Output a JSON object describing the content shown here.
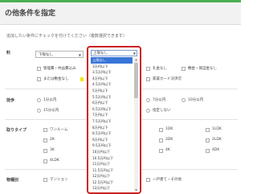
{
  "header": {
    "title": "の他条件を指定"
  },
  "instruction": "追加したい条件にチェックを付けてください（複数選択できます）",
  "rows": {
    "rent": {
      "label": "料",
      "min_select": "下限なし",
      "checkboxes_left": [
        "管理費・共益費込み",
        "または敷金なし"
      ],
      "checkboxes_right": [
        "礼金なし",
        "敷金・保証金なし",
        "家賃カード決済可"
      ]
    },
    "walk": {
      "label": "徒歩",
      "options_left": [
        "1分以内",
        "15分以内"
      ],
      "options_right": [
        "7分以内",
        "10分以内",
        "指定しない"
      ]
    },
    "layout": {
      "label": "取りタイプ",
      "options_left": [
        "ワンルーム",
        "2K",
        "3K",
        "4LDK"
      ],
      "options_right": [
        "1DK",
        "1LDK",
        "2DK",
        "2LDK",
        "4K",
        "4DK"
      ]
    },
    "building": {
      "label": "物種別",
      "options_left": [
        "マンション"
      ],
      "options_right": [
        "一戸建て・その他"
      ]
    }
  },
  "dropdown": {
    "current": "上限なし",
    "options": [
      "上限なし",
      "3万円以下",
      "3.5万円以下",
      "4万円以下",
      "4.5万円以下",
      "5万円以下",
      "5.5万円以下",
      "6万円以下",
      "6.5万円以下",
      "7万円以下",
      "7.5万円以下",
      "8万円以下",
      "8.5万円以下",
      "9万円以下",
      "9.5万円以下",
      "10万円以下",
      "10.5万円以下",
      "11万円以下",
      "11.5万円以下",
      "12万円以下",
      "12.5万円以下",
      "13万円以下"
    ]
  },
  "colors": {
    "accent": "#4caf50",
    "highlight": "#cc2222",
    "selected": "#3875d7"
  }
}
